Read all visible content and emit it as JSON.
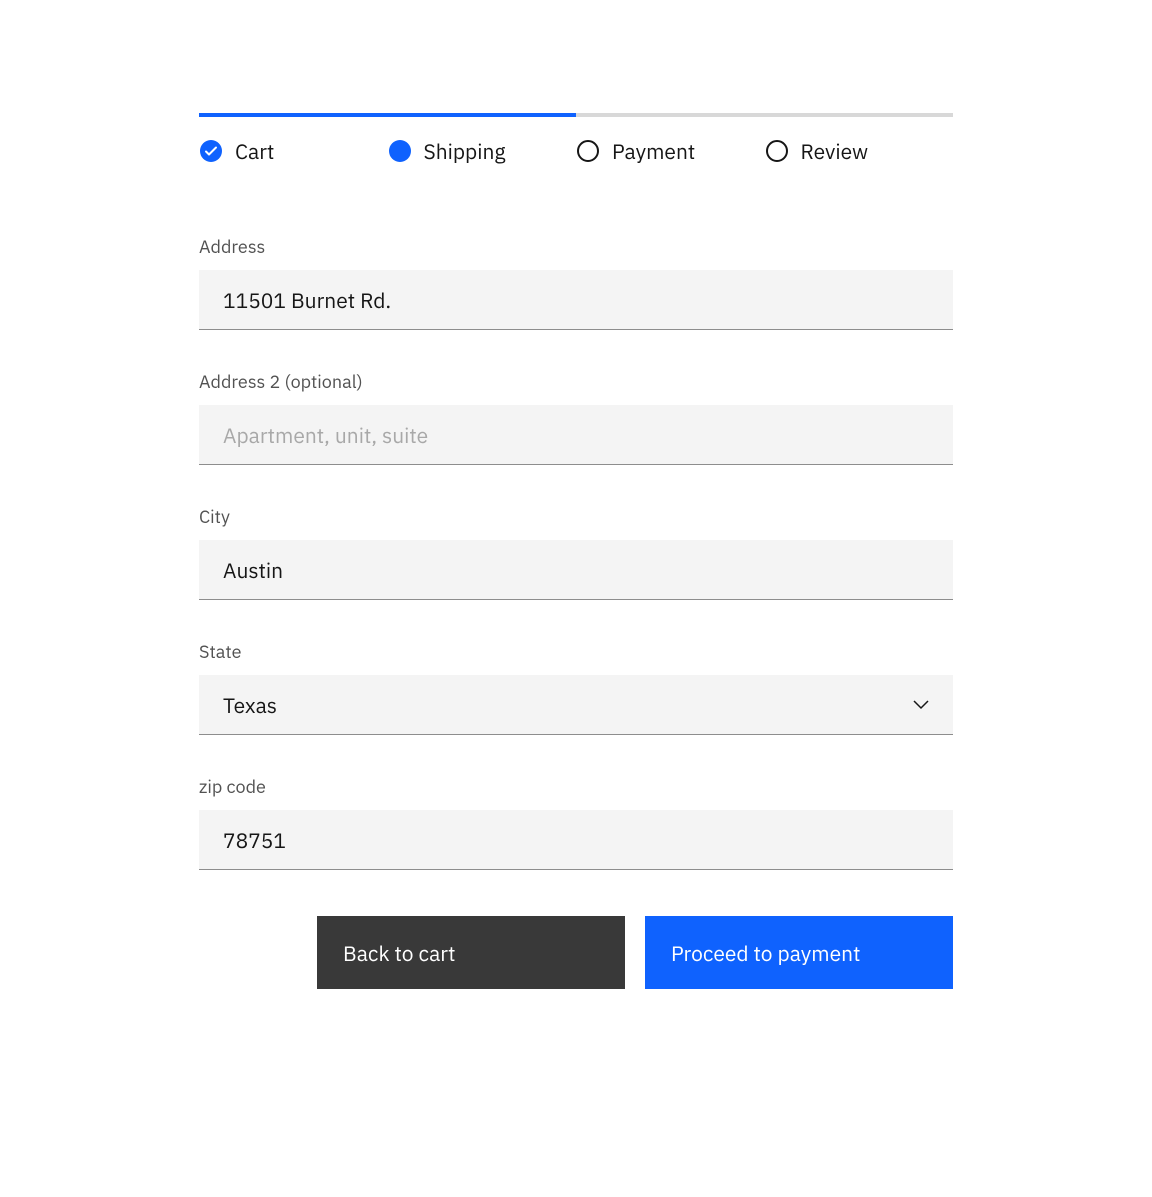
{
  "progress": {
    "steps": [
      {
        "label": "Cart",
        "state": "complete"
      },
      {
        "label": "Shipping",
        "state": "current"
      },
      {
        "label": "Payment",
        "state": "upcoming"
      },
      {
        "label": "Review",
        "state": "upcoming"
      }
    ]
  },
  "form": {
    "address": {
      "label": "Address",
      "value": "11501 Burnet Rd."
    },
    "address2": {
      "label": "Address 2 (optional)",
      "placeholder": "Apartment, unit, suite",
      "value": ""
    },
    "city": {
      "label": "City",
      "value": "Austin"
    },
    "state": {
      "label": "State",
      "value": "Texas"
    },
    "zip": {
      "label": "zip code",
      "value": "78751"
    }
  },
  "buttons": {
    "back": "Back to cart",
    "proceed": "Proceed to payment"
  }
}
